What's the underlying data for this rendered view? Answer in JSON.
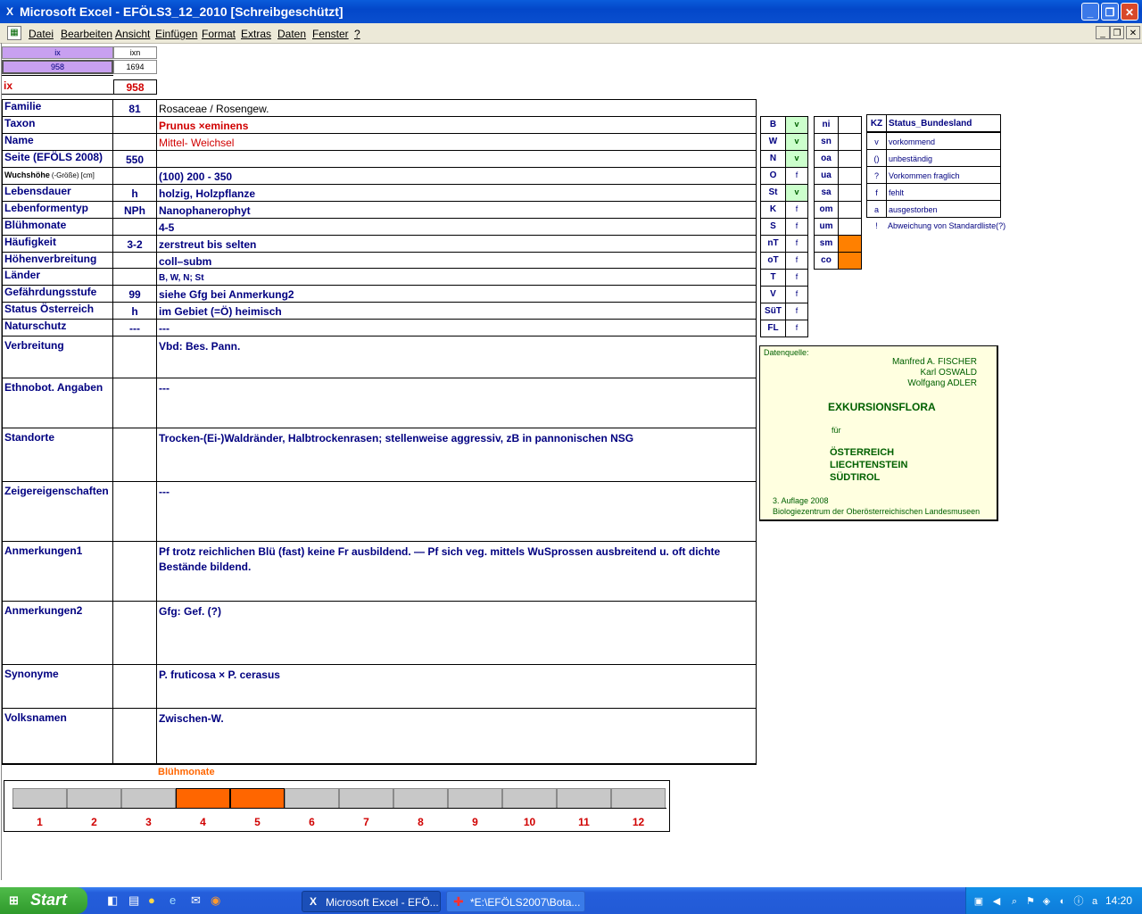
{
  "window": {
    "title": "Microsoft Excel - EFÖLS3_12_2010  [Schreibgeschützt]",
    "app_icon": "X",
    "controls": [
      "_",
      "❐",
      "✕"
    ]
  },
  "menu": {
    "items": [
      "Datei",
      "Bearbeiten",
      "Ansicht",
      "Einfügen",
      "Format",
      "Extras",
      "Daten",
      "Fenster",
      "?"
    ],
    "mdi_controls": [
      "_",
      "❐",
      "✕"
    ]
  },
  "top_cells": {
    "ix_header": "ix",
    "ixn_header": "ixn",
    "ix_value": "958",
    "ixn_value": "1694",
    "ix_label": "ix",
    "ix_big": "958"
  },
  "rows": [
    {
      "label": "Familie",
      "code": "81",
      "value": "Rosaceae  /  Rosengew."
    },
    {
      "label": "Taxon",
      "code": "",
      "value": "Prunus ×eminens"
    },
    {
      "label": "Name",
      "code": "",
      "value": "Mittel- Weichsel"
    },
    {
      "label": "Seite (EFÖLS 2008)",
      "code": "550",
      "value": ""
    },
    {
      "label": "Wuchshöhe",
      "label_small": "(-Größe) [cm]",
      "code": "",
      "value": "(100) 200 - 350"
    },
    {
      "label": "Lebensdauer",
      "code": "h",
      "value": "holzig, Holzpflanze"
    },
    {
      "label": "Lebenformentyp",
      "code": "NPh",
      "value": "Nanophanerophyt"
    },
    {
      "label": "Blühmonate",
      "code": "",
      "value": " 4-5"
    },
    {
      "label": "Häufigkeit",
      "code": "3-2",
      "value": "zerstreut bis selten"
    },
    {
      "label": "Höhenverbreitung",
      "code": "",
      "value": "coll–subm"
    },
    {
      "label": "Länder",
      "code": "",
      "value": "B, W, N; St"
    },
    {
      "label": "Gefährdungsstufe",
      "code": "99",
      "value": "siehe Gfg bei Anmerkung2"
    },
    {
      "label": "Status Österreich",
      "code": "h",
      "value": "im Gebiet (=Ö) heimisch"
    },
    {
      "label": "Naturschutz",
      "code": "---",
      "value": "---"
    }
  ],
  "big_rows": [
    {
      "label": "Verbreitung",
      "value": "Vbd: Bes. Pann."
    },
    {
      "label": "Ethnobot. Angaben",
      "value": "---"
    },
    {
      "label": "Standorte",
      "value": "Trocken-(Ei-)Waldränder, Halbtrockenrasen; stellenweise aggressiv, zB in pannonischen NSG"
    },
    {
      "label": "Zeigereigenschaften",
      "value": "---"
    },
    {
      "label": "Anmerkungen1",
      "value": "Pf trotz reichlichen Blü (fast) keine Fr ausbildend. — Pf sich veg. mittels WuSprossen ausbreitend u. oft dichte",
      "value2": "Bestände bildend."
    },
    {
      "label": "Anmerkungen2",
      "value": " Gfg: Gef. (?)"
    },
    {
      "label": "Synonyme",
      "value": "P. fruticosa × P. cerasus"
    },
    {
      "label": "Volksnamen",
      "value": "Zwischen-W."
    }
  ],
  "states": [
    {
      "code": "B",
      "status": "v"
    },
    {
      "code": "W",
      "status": "v"
    },
    {
      "code": "N",
      "status": "v"
    },
    {
      "code": "O",
      "status": "f"
    },
    {
      "code": "St",
      "status": "v"
    },
    {
      "code": "K",
      "status": "f"
    },
    {
      "code": "S",
      "status": "f"
    },
    {
      "code": "nT",
      "status": "f"
    },
    {
      "code": "oT",
      "status": "f"
    },
    {
      "code": "T",
      "status": "f"
    },
    {
      "code": "V",
      "status": "f"
    },
    {
      "code": "SüT",
      "status": "f"
    },
    {
      "code": "FL",
      "status": "f"
    }
  ],
  "altitude": [
    {
      "code": "ni"
    },
    {
      "code": "sn"
    },
    {
      "code": "oa"
    },
    {
      "code": "ua"
    },
    {
      "code": "sa"
    },
    {
      "code": "om"
    },
    {
      "code": "um"
    },
    {
      "code": "sm"
    },
    {
      "code": "co"
    }
  ],
  "legend": {
    "kz_header": "KZ",
    "title": "Status_Bundesland",
    "items": [
      {
        "kz": "v",
        "text": "vorkommend"
      },
      {
        "kz": "()",
        "text": "unbeständig"
      },
      {
        "kz": "?",
        "text": "Vorkommen fraglich"
      },
      {
        "kz": "f",
        "text": "fehlt"
      },
      {
        "kz": "a",
        "text": "ausgestorben"
      },
      {
        "kz": "!",
        "text": "Abweichung von Standardliste(?)"
      }
    ]
  },
  "source": {
    "label": "Datenquelle:",
    "authors": [
      "Manfred A. FISCHER",
      "Karl OSWALD",
      "Wolfgang ADLER"
    ],
    "title": "EXKURSIONSFLORA",
    "fuer": "für",
    "countries": [
      "ÖSTERREICH",
      "LIECHTENSTEIN",
      "SÜDTIROL"
    ],
    "edition": "3. Auflage 2008",
    "publisher": "Biologiezentrum der Oberösterreichischen Landesmuseen"
  },
  "bloom": {
    "title": "Blühmonate",
    "months": [
      "1",
      "2",
      "3",
      "4",
      "5",
      "6",
      "7",
      "8",
      "9",
      "10",
      "11",
      "12"
    ],
    "active": [
      4,
      5
    ],
    "active_color": "#ff6600",
    "inactive_color": "#c8c8c8"
  },
  "taskbar": {
    "start": "Start",
    "tasks": [
      "Microsoft Excel - EFÖ...",
      "*E:\\EFÖLS2007\\Bota..."
    ],
    "clock": "14:20"
  },
  "colors": {
    "label_blue": "#000080",
    "taxon_red": "#d00000",
    "ix_purple": "#c8a0f0",
    "status_green": "#ccffcc",
    "alt_orange": "#ff8000",
    "source_bg": "#ffffe0"
  }
}
